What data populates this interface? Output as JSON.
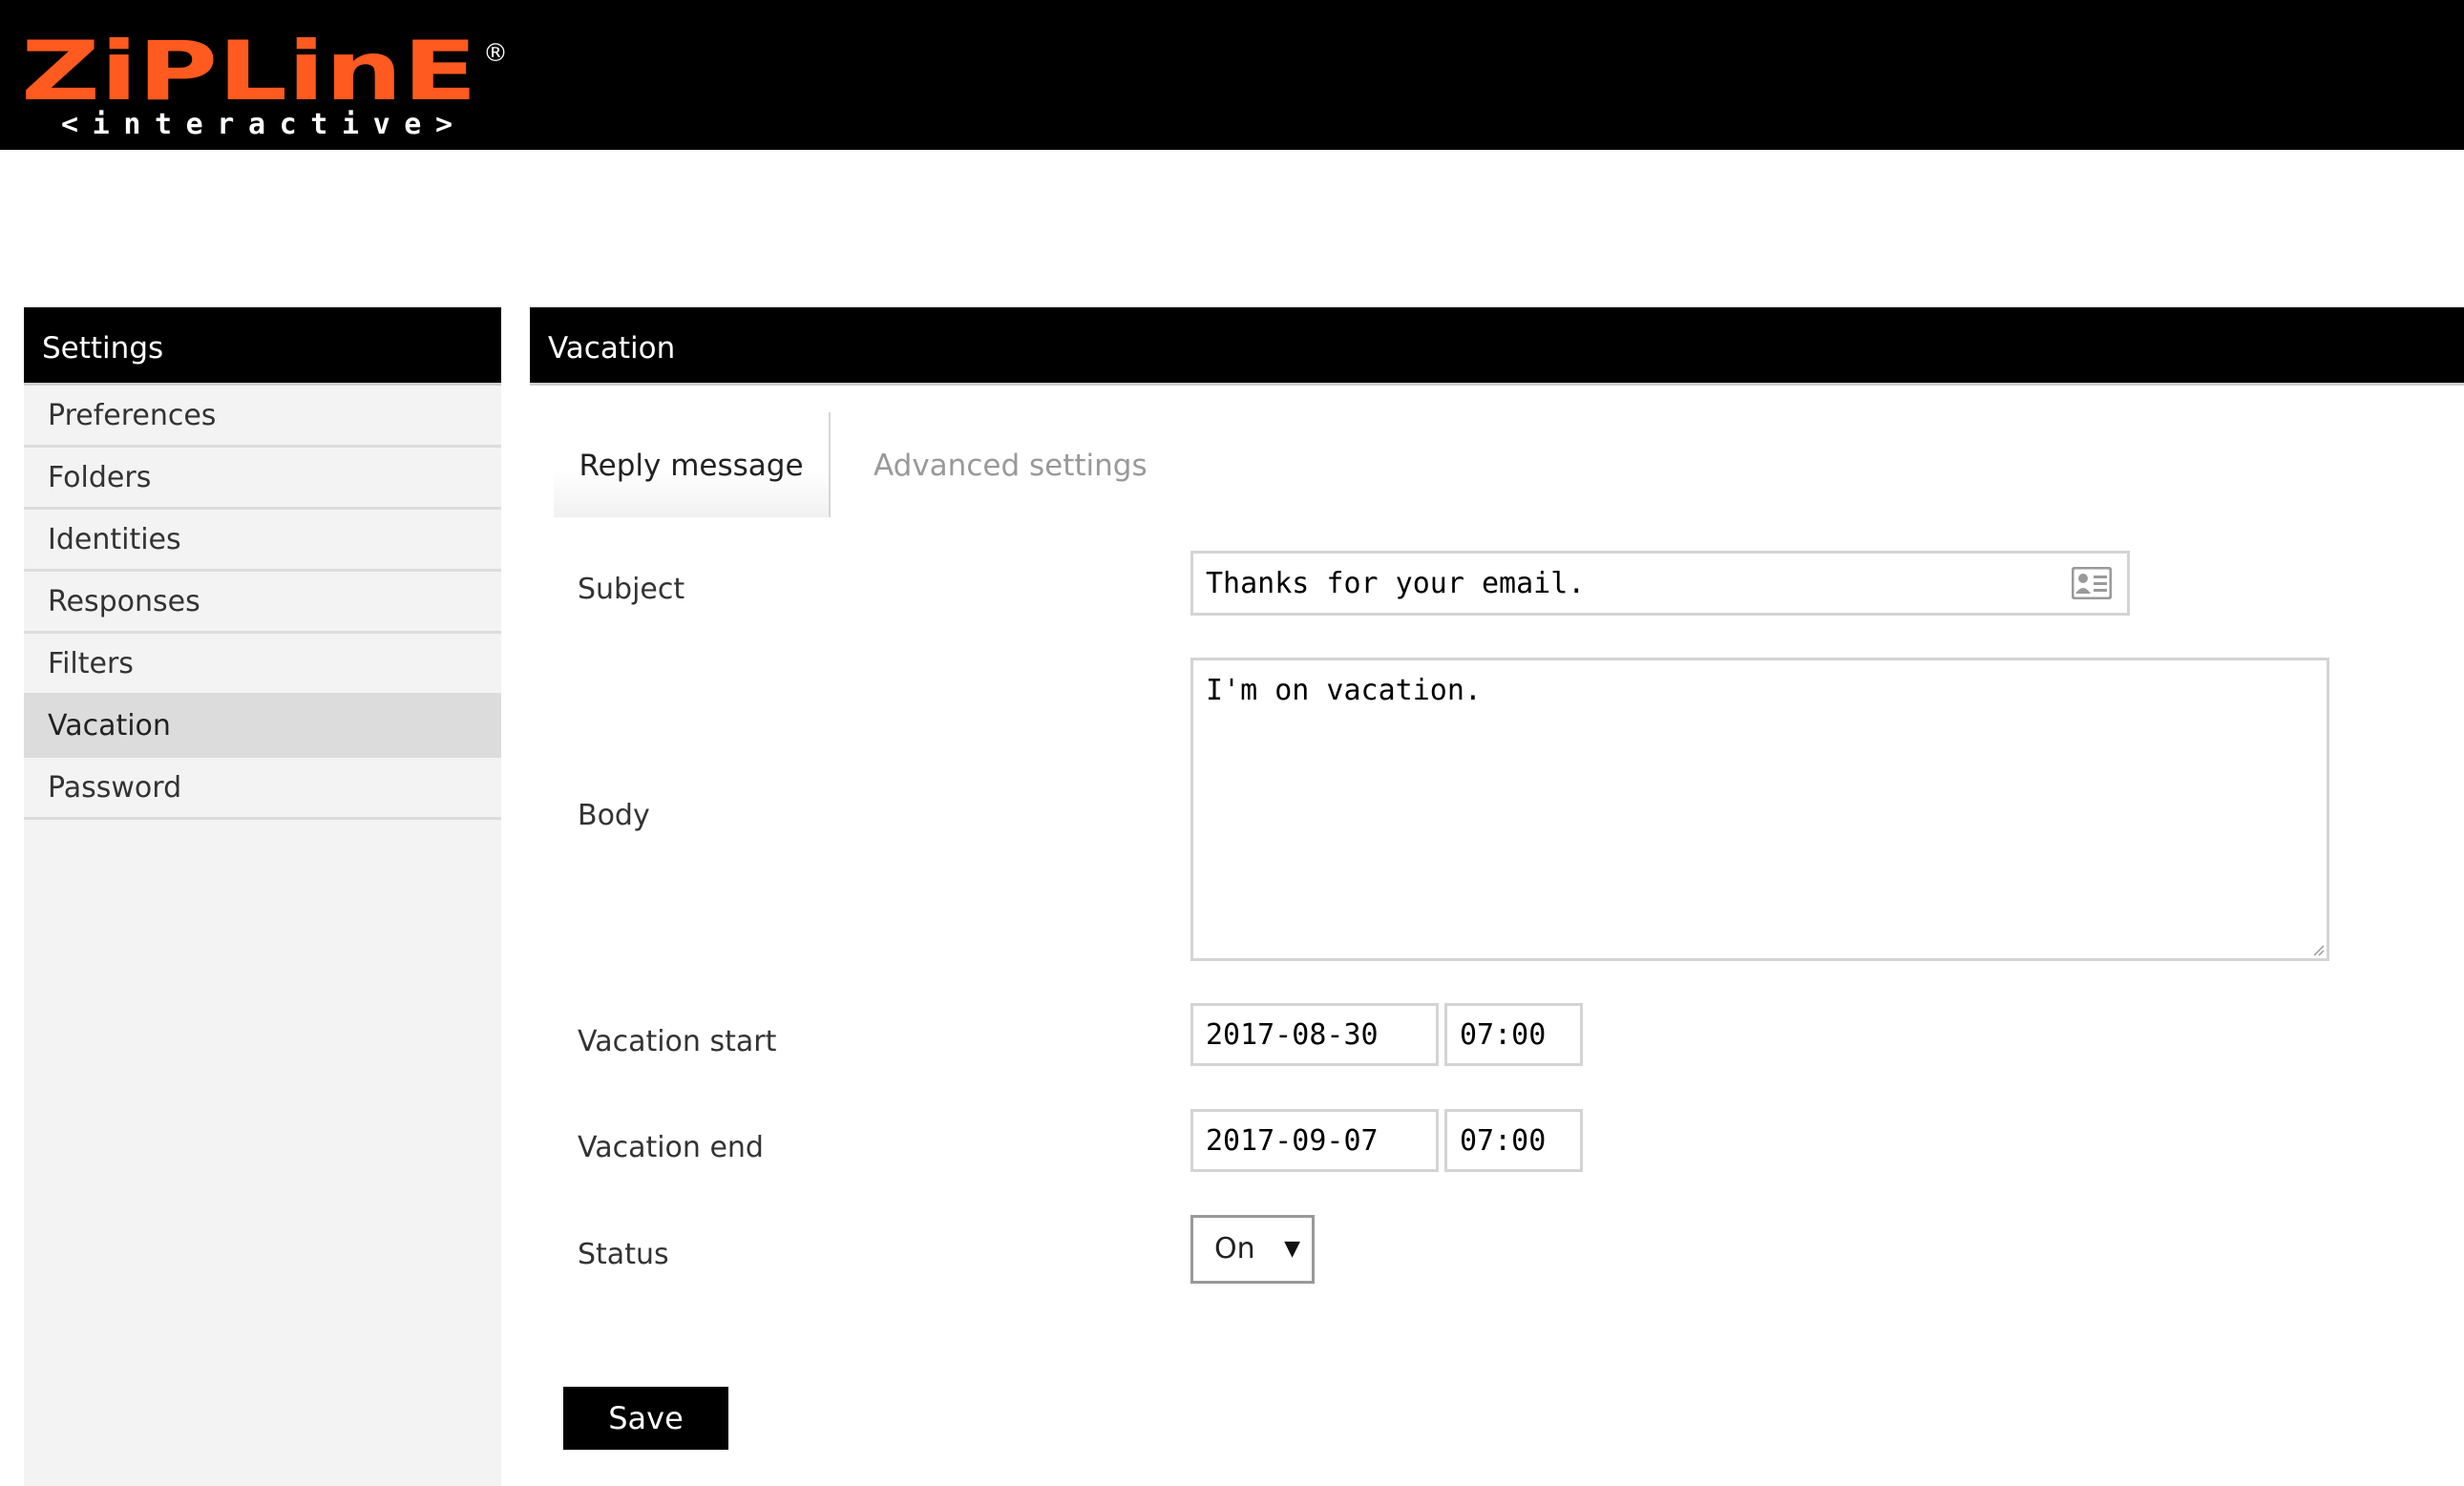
{
  "brand": {
    "logo_text": "ZiPLinE",
    "logo_subtext": "<interactive>",
    "logo_mark": "®",
    "accent_color": "#ff5a1f"
  },
  "sidebar": {
    "title": "Settings",
    "items": [
      {
        "label": "Preferences",
        "active": false
      },
      {
        "label": "Folders",
        "active": false
      },
      {
        "label": "Identities",
        "active": false
      },
      {
        "label": "Responses",
        "active": false
      },
      {
        "label": "Filters",
        "active": false
      },
      {
        "label": "Vacation",
        "active": true
      },
      {
        "label": "Password",
        "active": false
      }
    ]
  },
  "main": {
    "title": "Vacation",
    "tabs": [
      {
        "label": "Reply message",
        "active": true
      },
      {
        "label": "Advanced settings",
        "active": false
      }
    ],
    "form": {
      "subject_label": "Subject",
      "subject_value": "Thanks for your email.",
      "subject_icon": "contact-card-icon",
      "body_label": "Body",
      "body_value": "I'm on vacation.",
      "start_label": "Vacation start",
      "start_date": "2017-08-30",
      "start_time": "07:00",
      "end_label": "Vacation end",
      "end_date": "2017-09-07",
      "end_time": "07:00",
      "status_label": "Status",
      "status_value": "On",
      "status_arrow": "▼"
    },
    "save_label": "Save"
  }
}
